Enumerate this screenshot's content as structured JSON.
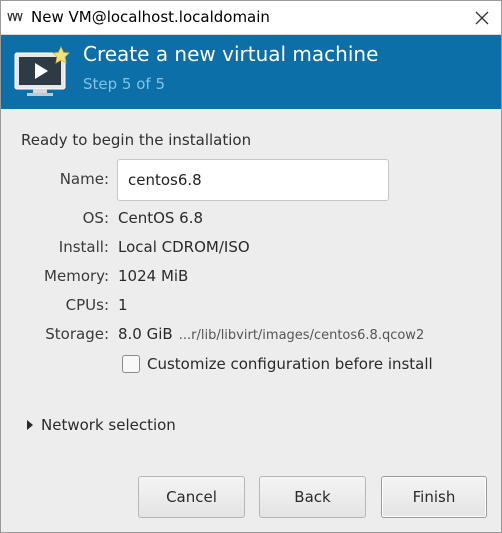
{
  "window": {
    "title": "New VM@localhost.localdomain"
  },
  "header": {
    "heading": "Create a new virtual machine",
    "step": "Step 5 of 5"
  },
  "summary": {
    "ready_text": "Ready to begin the installation",
    "name_label": "Name:",
    "name_value": "centos6.8",
    "os_label": "OS:",
    "os_value": "CentOS 6.8",
    "install_label": "Install:",
    "install_value": "Local CDROM/ISO",
    "memory_label": "Memory:",
    "memory_value": "1024 MiB",
    "cpus_label": "CPUs:",
    "cpus_value": "1",
    "storage_label": "Storage:",
    "storage_value": "8.0 GiB",
    "storage_path": "...r/lib/libvirt/images/centos6.8.qcow2"
  },
  "options": {
    "customize_label": "Customize configuration before install",
    "customize_checked": false,
    "network_label": "Network selection"
  },
  "buttons": {
    "cancel": "Cancel",
    "back": "Back",
    "finish": "Finish"
  },
  "colors": {
    "banner": "#0d6fa8",
    "step_text": "#7fc4e8"
  },
  "icons": {
    "app": "virt-manager-icon",
    "close": "close-icon",
    "banner": "monitor-play-icon",
    "expander": "triangle-right-icon"
  }
}
